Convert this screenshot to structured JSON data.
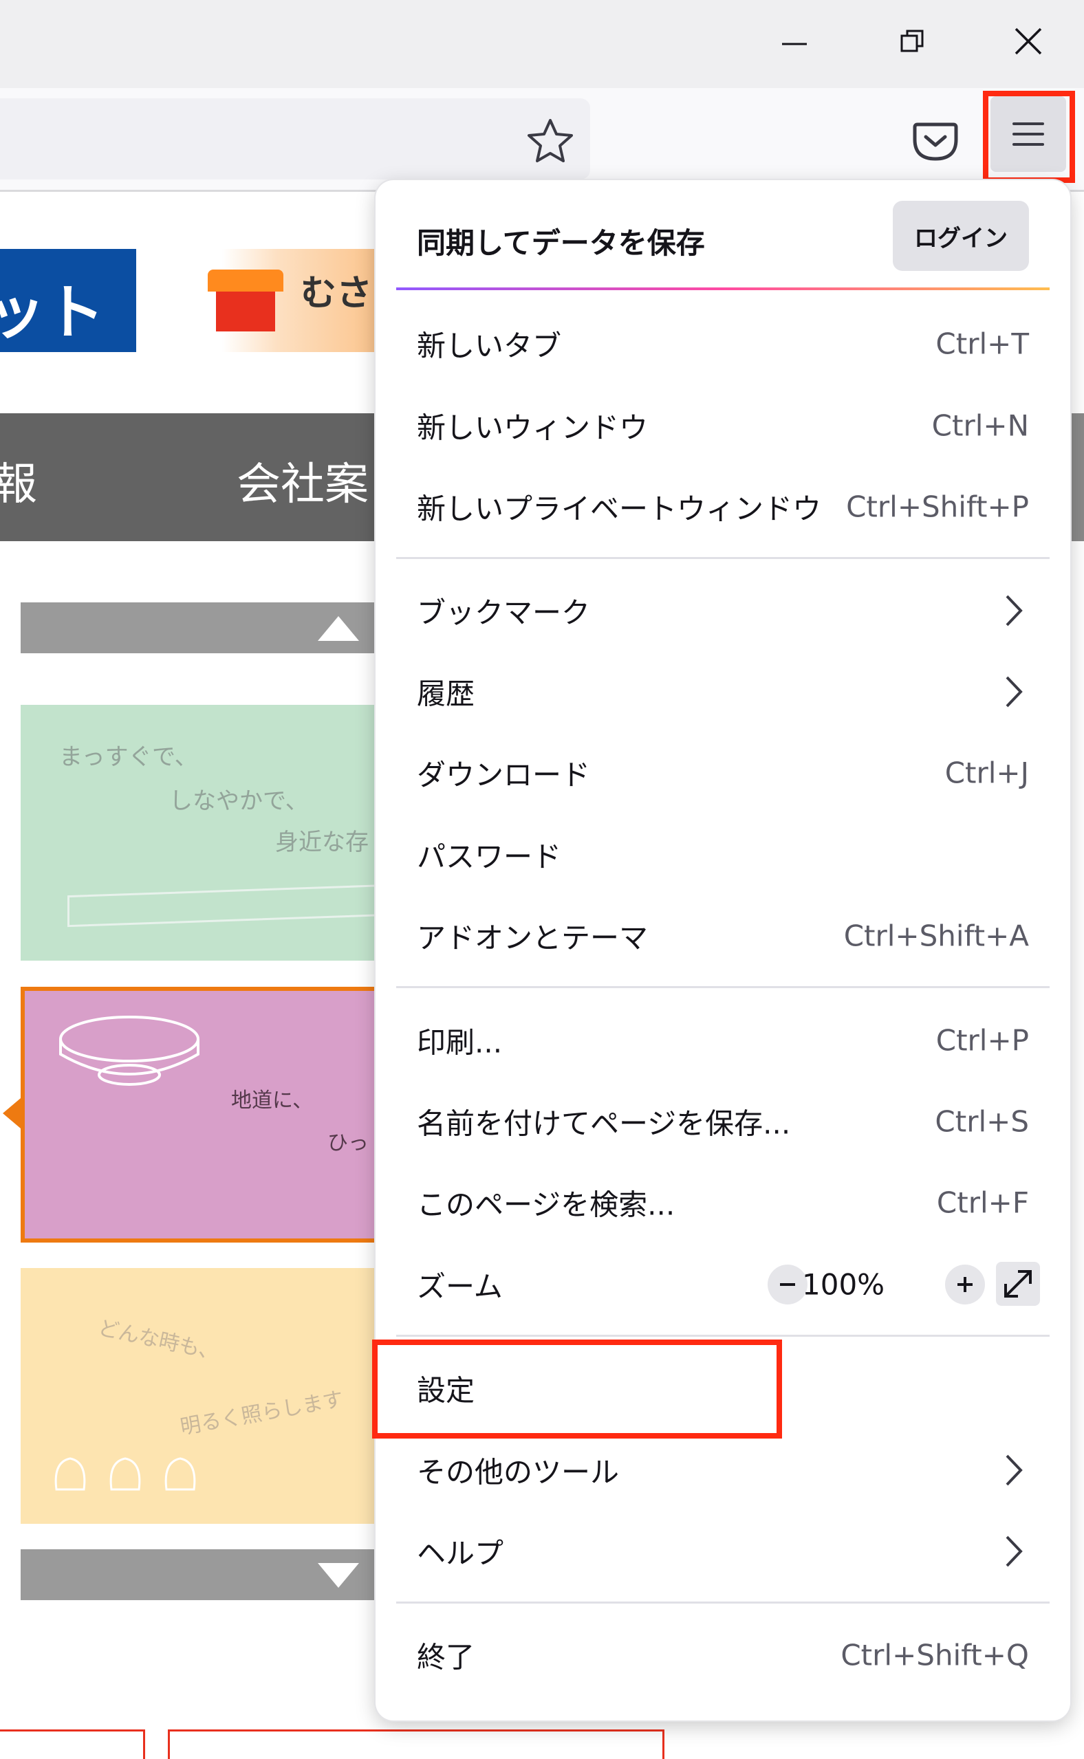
{
  "window_controls": [
    "minimize-icon",
    "restore-icon",
    "close-icon"
  ],
  "toolbar": {
    "icons": [
      "bookmark-star-icon",
      "pocket-icon",
      "hamburger-menu-icon"
    ]
  },
  "page": {
    "banner_text_1": "ット",
    "banner_text_2": "むさ",
    "nav_text_1": "報",
    "nav_text_2": "会社案",
    "card1_lines": [
      "まっすぐで、",
      "しなやかで、",
      "身近な存"
    ],
    "card2_lines": [
      "地道に、",
      "ひっ"
    ],
    "card3_lines": [
      "どんな時も、",
      "明るく照らします"
    ]
  },
  "menu": {
    "sync_label": "同期してデータを保存",
    "login_label": "ログイン",
    "items": [
      {
        "label": "新しいタブ",
        "shortcut": "Ctrl+T"
      },
      {
        "label": "新しいウィンドウ",
        "shortcut": "Ctrl+N"
      },
      {
        "label": "新しいプライベートウィンドウ",
        "shortcut": "Ctrl+Shift+P"
      },
      {
        "label": "ブックマーク",
        "shortcut": ""
      },
      {
        "label": "履歴",
        "shortcut": ""
      },
      {
        "label": "ダウンロード",
        "shortcut": "Ctrl+J"
      },
      {
        "label": "パスワード",
        "shortcut": ""
      },
      {
        "label": "アドオンとテーマ",
        "shortcut": "Ctrl+Shift+A"
      },
      {
        "label": "印刷...",
        "shortcut": "Ctrl+P"
      },
      {
        "label": "名前を付けてページを保存...",
        "shortcut": "Ctrl+S"
      },
      {
        "label": "このページを検索...",
        "shortcut": "Ctrl+F"
      },
      {
        "label": "ズーム",
        "shortcut": ""
      },
      {
        "label": "設定",
        "shortcut": ""
      },
      {
        "label": "その他のツール",
        "shortcut": ""
      },
      {
        "label": "ヘルプ",
        "shortcut": ""
      },
      {
        "label": "終了",
        "shortcut": "Ctrl+Shift+Q"
      }
    ],
    "zoom_value": "100%"
  },
  "colors": {
    "highlight": "#ff2a11",
    "nav_bar": "#636363",
    "banner_blue": "#0b4ea2",
    "card_green": "#c2e3cc",
    "card_pink": "#d89fc9",
    "card_yellow": "#fde4b0",
    "card_border_orange": "#ee7a11"
  }
}
